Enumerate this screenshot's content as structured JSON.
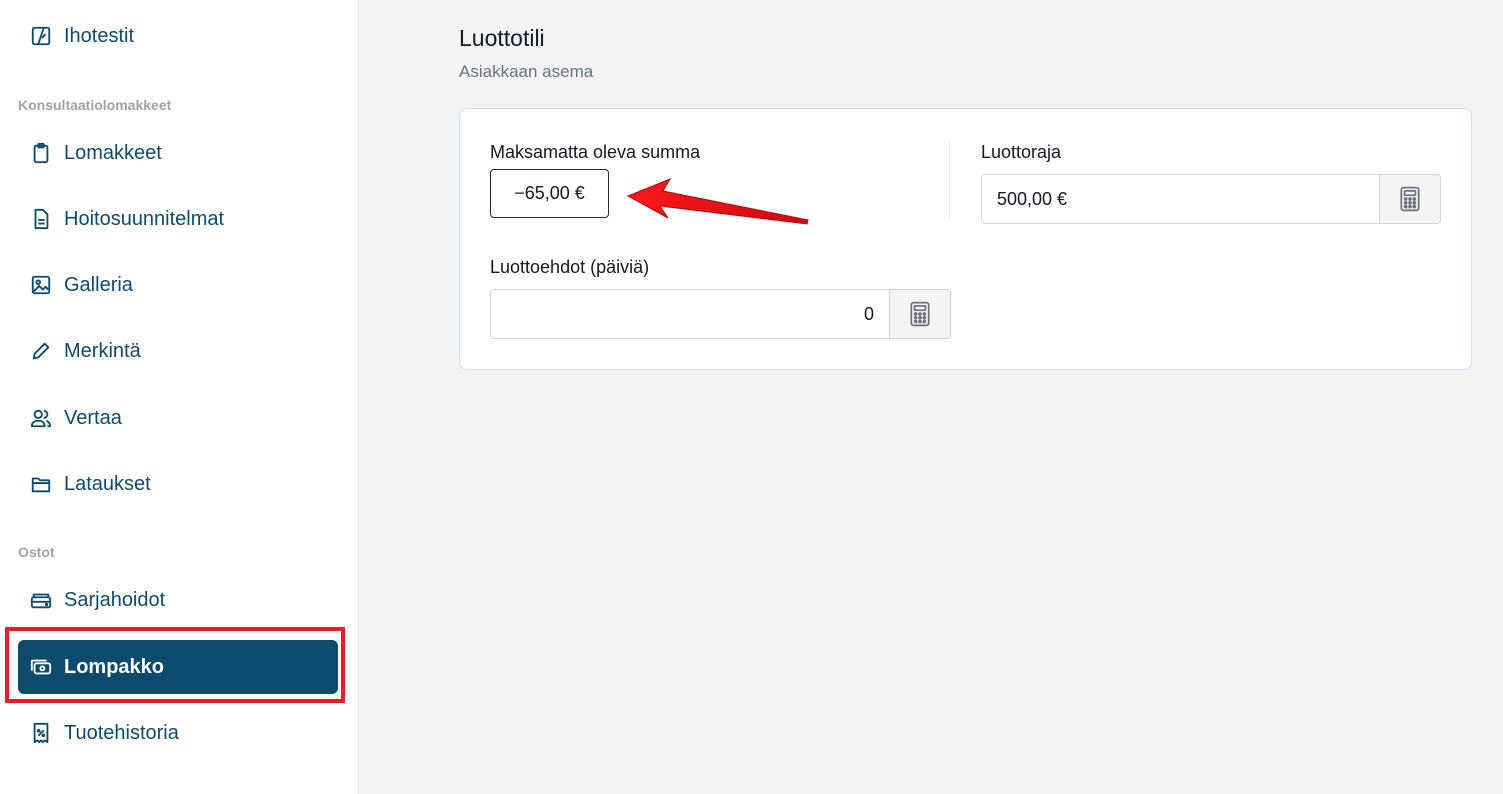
{
  "sidebar": {
    "items_top": [
      {
        "label": "Ihotestit",
        "icon": "skin-test-icon"
      }
    ],
    "section_consultation": "Konsultaatiolomakkeet",
    "items_consultation": [
      {
        "label": "Lomakkeet",
        "icon": "clipboard-icon"
      },
      {
        "label": "Hoitosuunnitelmat",
        "icon": "document-icon"
      },
      {
        "label": "Galleria",
        "icon": "image-icon"
      },
      {
        "label": "Merkintä",
        "icon": "pencil-icon"
      },
      {
        "label": "Vertaa",
        "icon": "users-icon"
      },
      {
        "label": "Lataukset",
        "icon": "folder-icon"
      }
    ],
    "section_purchases": "Ostot",
    "items_purchases": [
      {
        "label": "Sarjahoidot",
        "icon": "card-stack-icon"
      },
      {
        "label": "Lompakko",
        "icon": "wallet-icon",
        "active": true
      },
      {
        "label": "Tuotehistoria",
        "icon": "receipt-icon"
      }
    ]
  },
  "main": {
    "title": "Luottotili",
    "subtitle": "Asiakkaan asema",
    "outstanding_label": "Maksamatta oleva summa",
    "outstanding_value": "−65,00 €",
    "credit_limit_label": "Luottoraja",
    "credit_limit_value": "500,00 €",
    "credit_terms_label": "Luottoehdot (päiviä)",
    "credit_terms_value": "0"
  },
  "colors": {
    "accent": "#0e4a6b",
    "highlight": "#e0202a",
    "arrow": "#e8141b"
  }
}
